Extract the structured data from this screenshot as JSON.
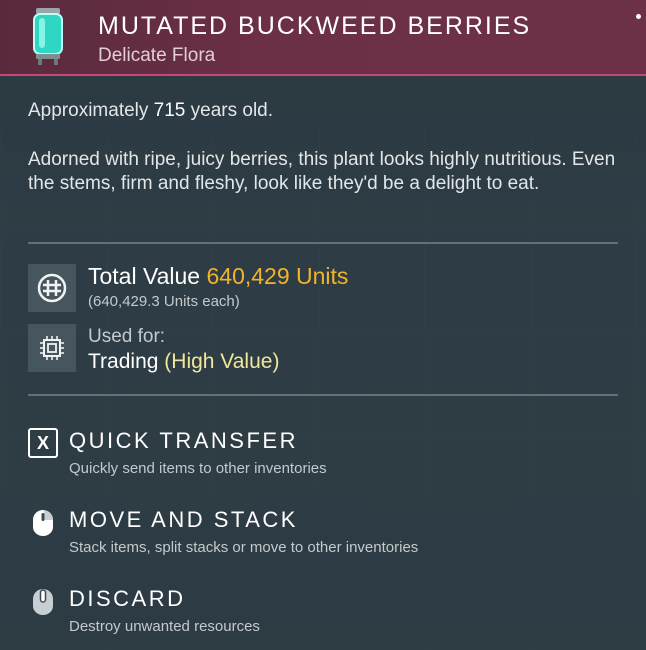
{
  "item": {
    "name": "MUTATED BUCKWEED BERRIES",
    "category": "Delicate Flora"
  },
  "age": {
    "prefix": "Approximately",
    "value": "715",
    "suffix": "years old."
  },
  "description": "Adorned with ripe, juicy berries, this plant looks highly nutritious. Even the stems, firm and fleshy, look like they'd be a delight to eat.",
  "value": {
    "label": "Total Value",
    "amount": "640,429 Units",
    "each": "(640,429.3 Units each)",
    "icon": "units-icon"
  },
  "usage": {
    "label": "Used for:",
    "purpose": "Trading",
    "qualifier": "(High Value)",
    "icon": "chip-icon"
  },
  "actions": [
    {
      "key": "X",
      "title": "QUICK TRANSFER",
      "subtitle": "Quickly send items to other inventories",
      "icon": "x-key-icon"
    },
    {
      "key": "",
      "title": "MOVE AND STACK",
      "subtitle": "Stack items, split stacks or move to other inventories",
      "icon": "mouse-left-icon"
    },
    {
      "key": "",
      "title": "DISCARD",
      "subtitle": "Destroy unwanted resources",
      "icon": "mouse-middle-icon"
    }
  ],
  "colors": {
    "header": "#6b2f47",
    "header_border": "#c8477a",
    "value_accent": "#f2b329",
    "qualifier_accent": "#f1e79a"
  }
}
